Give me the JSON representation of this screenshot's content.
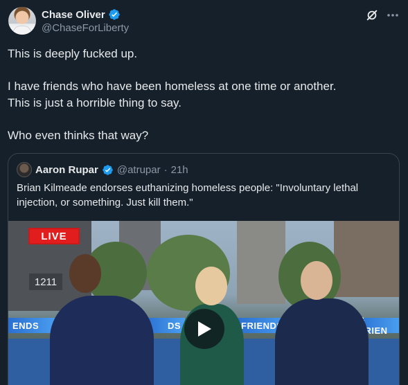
{
  "author": {
    "name": "Chase Oliver",
    "handle": "@ChaseForLiberty"
  },
  "icons": {
    "verified": "verified-badge-icon",
    "grok": "grok-icon",
    "more": "more-icon",
    "play": "play-icon"
  },
  "tweet": {
    "lines": [
      "This is deeply fucked up.",
      "",
      "I have friends who have been homeless at one time or another.",
      "This is just a horrible thing to say.",
      "",
      "Who even thinks that way?"
    ]
  },
  "quote": {
    "name": "Aaron Rupar",
    "handle": "@atrupar",
    "separator": "·",
    "time": "21h",
    "text": "Brian Kilmeade endorses euthanizing homeless people: \"Involuntary lethal injection, or something. Just kill them.\""
  },
  "video": {
    "live_label": "LIVE",
    "address": "1211",
    "banner_left": "ENDS",
    "banner_mid_left": "DS",
    "banner_mid": "FRIENDS",
    "banner_right": "& FRIEN"
  },
  "colors": {
    "background": "#15202b",
    "text": "#e7e9ea",
    "muted": "#8b98a5",
    "verified": "#1d9bf0",
    "border": "#38444d",
    "live": "#e11d1d"
  }
}
